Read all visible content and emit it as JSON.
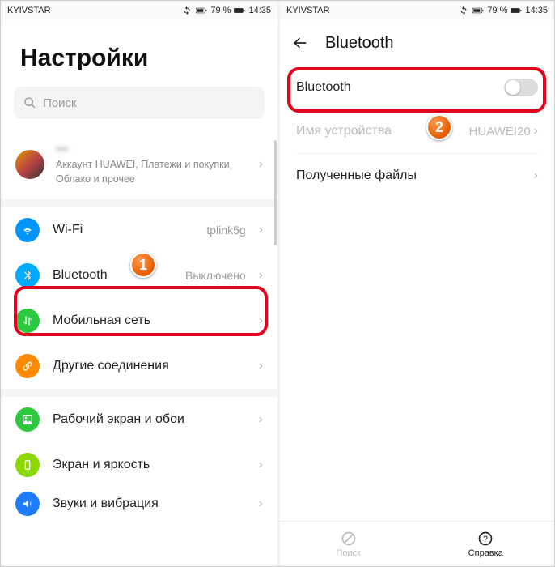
{
  "status": {
    "carrier": "KYIVSTAR",
    "battery": "79 %",
    "time": "14:35"
  },
  "left": {
    "title": "Настройки",
    "search_placeholder": "Поиск",
    "account_name": "—",
    "account_sub": "Аккаунт HUAWEI, Платежи и покупки, Облако и прочее",
    "items": [
      {
        "label": "Wi-Fi",
        "value": "tplink5g"
      },
      {
        "label": "Bluetooth",
        "value": "Выключено"
      },
      {
        "label": "Мобильная сеть",
        "value": ""
      },
      {
        "label": "Другие соединения",
        "value": ""
      },
      {
        "label": "Рабочий экран и обои",
        "value": ""
      },
      {
        "label": "Экран и яркость",
        "value": ""
      },
      {
        "label": "Звуки и вибрация",
        "value": ""
      }
    ]
  },
  "right": {
    "header": "Bluetooth",
    "rows": {
      "bluetooth": "Bluetooth",
      "device_name_label": "Имя устройства",
      "device_name_value": "HUAWEI20",
      "received": "Полученные файлы"
    },
    "bottom": {
      "search": "Поиск",
      "help": "Справка"
    }
  },
  "badges": {
    "one": "1",
    "two": "2"
  }
}
